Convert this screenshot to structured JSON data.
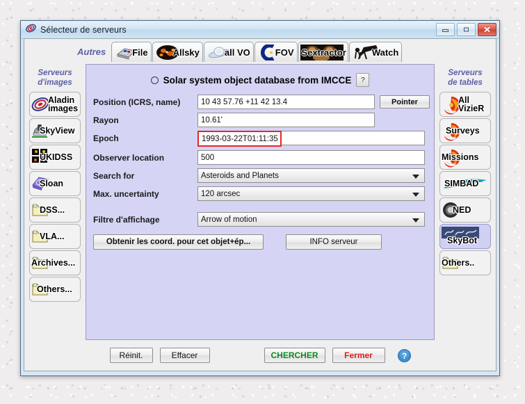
{
  "window": {
    "title": "Sélecteur de serveurs",
    "icon": "aladin-logo-icon",
    "minimize_label": "Réduire",
    "maximize_label": "Agrandir",
    "close_label": "Fermer"
  },
  "tabbar": {
    "autres_label": "Autres",
    "tabs": [
      {
        "label": "File",
        "icon": "file-disk-icon"
      },
      {
        "label": "Allsky",
        "icon": "allsky-icon"
      },
      {
        "label": "all VO",
        "icon": "allvo-icon"
      },
      {
        "label": "FOV",
        "icon": "fov-icon"
      },
      {
        "label": "Sextractor",
        "icon": "sextractor-icon"
      },
      {
        "label": "Watch",
        "icon": "watch-telescope-icon"
      }
    ]
  },
  "left_panel": {
    "heading_line1": "Serveurs",
    "heading_line2": "d'images",
    "items": [
      {
        "label_line1": "Aladin",
        "label_line2": "images",
        "icon": "aladin-spiral-icon",
        "selected": false
      },
      {
        "label_line1": "SkyView",
        "label_line2": "",
        "icon": "telescope-dome-icon",
        "selected": false
      },
      {
        "label_line1": "UKIDSS",
        "label_line2": "",
        "icon": "ukidss-tiles-icon",
        "selected": false
      },
      {
        "label_line1": "Sloan",
        "label_line2": "",
        "icon": "sloan-icon",
        "selected": false
      },
      {
        "label_line1": "DSS...",
        "label_line2": "",
        "icon": "folder-icon",
        "selected": false
      },
      {
        "label_line1": "VLA...",
        "label_line2": "",
        "icon": "folder-icon",
        "selected": false
      },
      {
        "label_line1": "Archives...",
        "label_line2": "",
        "icon": "folder-icon",
        "selected": false
      },
      {
        "label_line1": "Others...",
        "label_line2": "",
        "icon": "folder-icon",
        "selected": false
      }
    ]
  },
  "right_panel": {
    "heading_line1": "Serveurs",
    "heading_line2": "de tables",
    "items": [
      {
        "label_line1": "All",
        "label_line2": "VizieR",
        "icon": "vizier-icon",
        "selected": false
      },
      {
        "label_line1": "Surveys",
        "label_line2": "",
        "icon": "vizier-icon",
        "selected": false
      },
      {
        "label_line1": "Missions",
        "label_line2": "",
        "icon": "vizier-icon",
        "selected": false
      },
      {
        "label_line1": "SIMBAD",
        "label_line2": "",
        "icon": "simbad-icon",
        "selected": false
      },
      {
        "label_line1": "NED",
        "label_line2": "",
        "icon": "ned-icon",
        "selected": false
      },
      {
        "label_line1": "SkyBot",
        "label_line2": "",
        "icon": "imcce-icon",
        "selected": true
      },
      {
        "label_line1": "Others..",
        "label_line2": "",
        "icon": "folder-icon",
        "selected": false
      }
    ]
  },
  "form": {
    "title": "Solar system object database from IMCCE",
    "help_label": "?",
    "radio_selected": false,
    "fields": [
      {
        "label": "Position (ICRS, name)",
        "value": "10 43 57.76 +11 42 13.4",
        "type": "text"
      },
      {
        "label": "Rayon",
        "value": "10.61'",
        "type": "text"
      },
      {
        "label": "Epoch",
        "value": "1993-03-22T01:11:35",
        "type": "text-highlighted"
      },
      {
        "label": "Observer location",
        "value": "500",
        "type": "text"
      },
      {
        "label": "Search for",
        "value": "Asteroids and Planets",
        "type": "combo"
      },
      {
        "label": "Max. uncertainty",
        "value": "120 arcsec",
        "type": "combo"
      },
      {
        "label": "Filtre d'affichage",
        "value": "Arrow of motion",
        "type": "combo"
      }
    ],
    "pointer_button": "Pointer",
    "coord_button": "Obtenir les coord. pour cet objet+ép...",
    "info_button": "INFO serveur",
    "highlight_color": "#e02828",
    "panel_color": "#d5d4f5"
  },
  "footer": {
    "reinit": "Réinit.",
    "effacer": "Effacer",
    "chercher": "CHERCHER",
    "fermer": "Fermer",
    "help_icon": "help-circle-icon",
    "chercher_color": "#0b8a20",
    "fermer_color": "#e01b1b"
  }
}
